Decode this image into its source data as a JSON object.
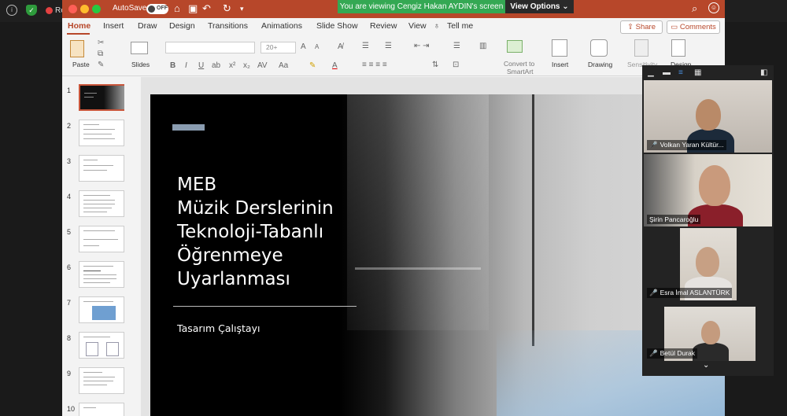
{
  "zoom": {
    "recording_label": "Recording",
    "share_banner": "You are viewing Cengiz Hakan AYDIN's screen",
    "view_options": "View Options ⌄"
  },
  "titlebar": {
    "autosave_label": "AutoSave",
    "autosave_state": "OFF"
  },
  "tabs": [
    "Home",
    "Insert",
    "Draw",
    "Design",
    "Transitions",
    "Animations",
    "Slide Show",
    "Review",
    "View",
    "Tell me"
  ],
  "share_label": "Share",
  "comments_label": "Comments",
  "ribbon": {
    "paste": "Paste",
    "slides": "Slides",
    "font_size": "20+",
    "convert_smartart_1": "Convert to",
    "convert_smartart_2": "SmartArt",
    "insert": "Insert",
    "drawing": "Drawing",
    "sensitivity": "Sensitivity",
    "design": "Design"
  },
  "thumbnails": [
    "1",
    "2",
    "3",
    "4",
    "5",
    "6",
    "7",
    "8",
    "9",
    "10"
  ],
  "slide": {
    "title_lines": [
      "MEB",
      "Müzik Derslerinin",
      "Teknoloji-Tabanlı",
      "Öğrenmeye",
      "Uyarlanması"
    ],
    "subtitle": "Tasarım Çalıştayı"
  },
  "participants": [
    {
      "name": "Volkan Yaran Kültür..."
    },
    {
      "name": "Şirin Pancaroğlu"
    },
    {
      "name": "Esra İmal ASLANTÜRK"
    },
    {
      "name": "Betül Durak"
    }
  ],
  "colors": {
    "ppt_accent": "#b7472a",
    "share_green": "#34a853",
    "mic_muted": "#e34141"
  }
}
